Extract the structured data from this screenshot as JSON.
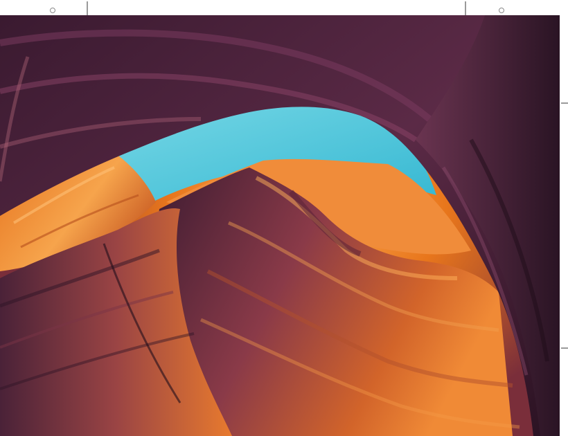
{
  "image": {
    "subject": "slot-canyon-photo",
    "colors": {
      "sky": "#48c4da",
      "sky_light": "#78d8e6",
      "rock_orange": "#e8761c",
      "rock_amber": "#f4a04a",
      "rock_purple": "#5a2a4a",
      "rock_dark": "#2e1626",
      "background": "#ffffff",
      "crop_mark": "#9a9a9a"
    }
  },
  "crop_marks": {
    "icons": [
      "crop-mark-icon",
      "registration-mark-icon"
    ]
  }
}
